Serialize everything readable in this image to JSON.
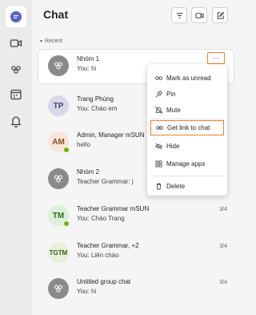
{
  "rail": {
    "items": [
      {
        "name": "chat",
        "icon": "chat-icon",
        "active": true
      },
      {
        "name": "calls",
        "icon": "video-icon"
      },
      {
        "name": "teams",
        "icon": "teams-icon"
      },
      {
        "name": "calendar",
        "icon": "calendar-icon"
      },
      {
        "name": "activity",
        "icon": "bell-icon"
      }
    ]
  },
  "header": {
    "title": "Chat",
    "buttons": [
      "filter-icon",
      "meet-icon",
      "new-chat-icon"
    ]
  },
  "section": {
    "label": "Recent"
  },
  "chats": [
    {
      "name": "Nhóm 1",
      "preview": "You: hi",
      "time": "",
      "avatar": "group",
      "selected": true
    },
    {
      "name": "Trang Phùng",
      "preview": "You: Chào em",
      "time": "",
      "avatar": "TP",
      "avatar_bg": "#d8d8e8",
      "avatar_fg": "#464775"
    },
    {
      "name": "Admin, Manager mSUN",
      "preview": "hello",
      "time": "",
      "avatar": "AM",
      "avatar_bg": "#f8e4d8",
      "avatar_fg": "#8a4a1e",
      "presence": true
    },
    {
      "name": "Nhóm 2",
      "preview": "Teacher Grammar: j",
      "time": "",
      "avatar": "group"
    },
    {
      "name": "Teacher Grammar mSUN",
      "preview": "You: Chào Trang",
      "time": "3/4",
      "avatar": "TM",
      "avatar_bg": "#dcefd8",
      "avatar_fg": "#2f6b1e",
      "presence": true
    },
    {
      "name": "Teacher Grammar, +2",
      "preview": "You: Liên chào",
      "time": "3/4",
      "avatar": "TGTM",
      "avatar_bg": "#e8f0d8",
      "avatar_fg": "#3a5a20"
    },
    {
      "name": "Untitled group chat",
      "preview": "You: hi",
      "time": "3/4",
      "avatar": "group"
    }
  ],
  "more_button": {
    "label": "···"
  },
  "context_menu": {
    "items": [
      {
        "label": "Mark as unread",
        "icon": "glasses-icon"
      },
      {
        "label": "Pin",
        "icon": "pin-icon"
      },
      {
        "label": "Mute",
        "icon": "mute-bell-icon"
      },
      {
        "label": "Get link to chat",
        "icon": "link-icon",
        "highlight": true
      },
      {
        "label": "Hide",
        "icon": "hide-eye-icon"
      },
      {
        "label": "Manage apps",
        "icon": "apps-icon"
      },
      {
        "label": "Delete",
        "icon": "trash-icon"
      }
    ]
  },
  "colors": {
    "accent": "#5b5fc7",
    "highlight_border": "#f07f26",
    "presence": "#6bb700"
  }
}
